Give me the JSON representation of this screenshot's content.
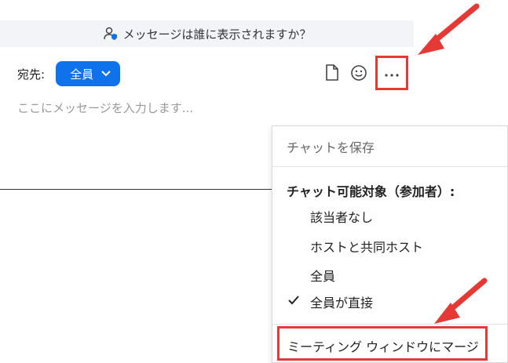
{
  "banner": {
    "text": "メッセージは誰に表示されますか？",
    "icon": "person-shield-icon"
  },
  "compose": {
    "to_label": "宛先:",
    "recipient": "全員",
    "placeholder": "ここにメッセージを入力します..."
  },
  "toolbar": {
    "icons": [
      "file-icon",
      "emoji-icon",
      "more-icon"
    ]
  },
  "menu": {
    "save_chat": "チャットを保存",
    "heading": "チャット可能対象（参加者）:",
    "options": [
      {
        "label": "該当者なし",
        "checked": false
      },
      {
        "label": "ホストと共同ホスト",
        "checked": false
      },
      {
        "label": "全員",
        "checked": false
      },
      {
        "label": "全員が直接",
        "checked": true
      }
    ],
    "merge": "ミーティング ウィンドウにマージ"
  },
  "colors": {
    "accent": "#0e72ed",
    "highlight": "#e53935",
    "banner_bg": "#f3f4f8"
  }
}
